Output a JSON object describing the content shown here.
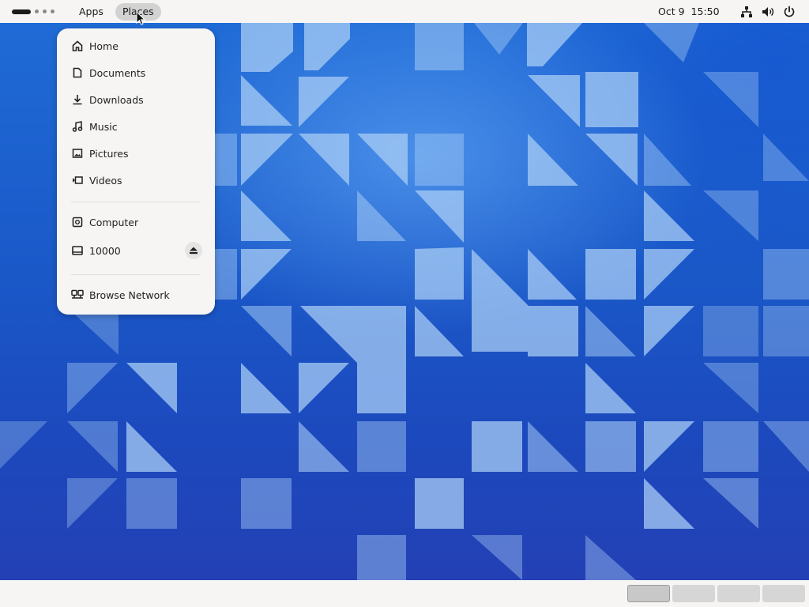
{
  "topbar": {
    "apps_label": "Apps",
    "places_label": "Places",
    "date": "Oct 9",
    "time": "15:50",
    "workspace_indicator": [
      "active",
      "inactive",
      "inactive",
      "inactive"
    ],
    "status_icons": [
      "network-icon",
      "volume-icon",
      "power-icon"
    ]
  },
  "places_menu": {
    "bookmarks": [
      {
        "label": "Home",
        "icon": "home-icon"
      },
      {
        "label": "Documents",
        "icon": "document-icon"
      },
      {
        "label": "Downloads",
        "icon": "download-icon"
      },
      {
        "label": "Music",
        "icon": "music-icon"
      },
      {
        "label": "Pictures",
        "icon": "picture-icon"
      },
      {
        "label": "Videos",
        "icon": "video-icon"
      }
    ],
    "devices": [
      {
        "label": "Computer",
        "icon": "computer-icon"
      },
      {
        "label": "10000",
        "icon": "drive-icon",
        "action_icon": "eject-icon"
      }
    ],
    "network": [
      {
        "label": "Browse Network",
        "icon": "network-browse-icon"
      }
    ]
  },
  "bottombar": {
    "workspace_thumbnails": [
      "active",
      "inactive",
      "inactive",
      "inactive"
    ]
  },
  "colors": {
    "panel": "#f6f5f4",
    "wallpaper_base": "#1a58c8",
    "wallpaper_tile": "#9cc3f0"
  }
}
